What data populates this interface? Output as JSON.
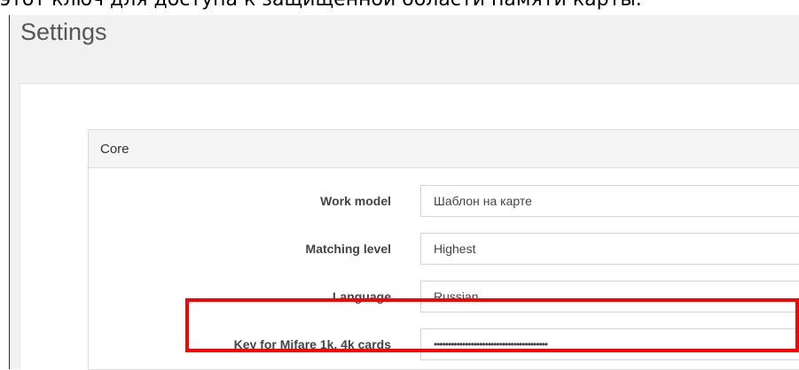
{
  "caption": "этот ключ для доступа к защищенной области памяти карты.",
  "page": {
    "title": "Settings"
  },
  "core": {
    "title": "Core",
    "fields": [
      {
        "label": "Work model",
        "value": "Шаблон на карте"
      },
      {
        "label": "Matching level",
        "value": "Highest"
      },
      {
        "label": "Language",
        "value": "Russian"
      },
      {
        "label": "Key for Mifare 1k, 4k cards",
        "value": "••••••••••••••••••••••••••••••••••••••••"
      }
    ]
  },
  "colors": {
    "highlight": "#ff0000",
    "frame_bg": "#f1f1f1"
  }
}
